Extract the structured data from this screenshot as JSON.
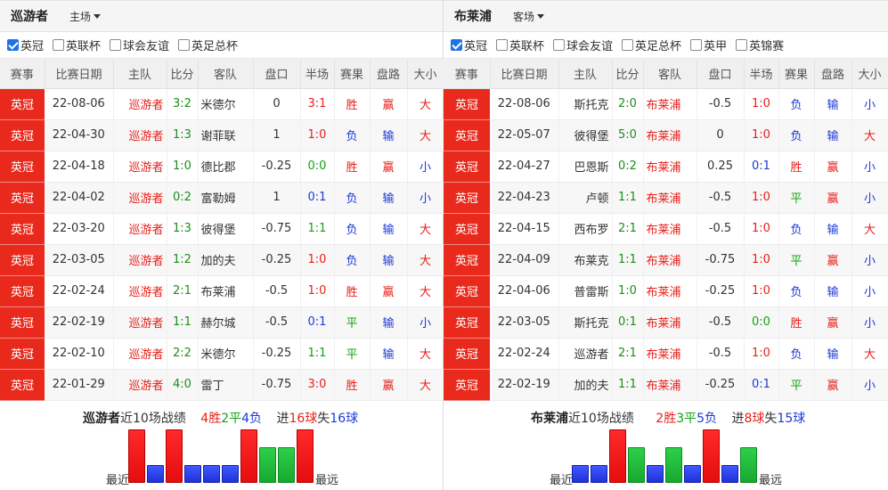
{
  "headers": [
    "赛事",
    "比赛日期",
    "主队",
    "比分",
    "客队",
    "盘口",
    "半场",
    "赛果",
    "盘路",
    "大小"
  ],
  "left": {
    "team": "巡游者",
    "venue": "主场",
    "filters": [
      {
        "label": "英冠",
        "checked": true
      },
      {
        "label": "英联杯",
        "checked": false
      },
      {
        "label": "球会友谊",
        "checked": false
      },
      {
        "label": "英足总杯",
        "checked": false
      }
    ],
    "rows": [
      {
        "comp": "英冠",
        "date": "22-08-06",
        "home": "巡游者",
        "score": "3:2",
        "away": "米德尔",
        "line": "0",
        "half": "3:1",
        "result": "胜",
        "handicap": "赢",
        "ou": "大"
      },
      {
        "comp": "英冠",
        "date": "22-04-30",
        "home": "巡游者",
        "score": "1:3",
        "away": "谢菲联",
        "line": "1",
        "half": "1:0",
        "result": "负",
        "handicap": "输",
        "ou": "大"
      },
      {
        "comp": "英冠",
        "date": "22-04-18",
        "home": "巡游者",
        "score": "1:0",
        "away": "德比郡",
        "line": "-0.25",
        "half": "0:0",
        "result": "胜",
        "handicap": "赢",
        "ou": "小"
      },
      {
        "comp": "英冠",
        "date": "22-04-02",
        "home": "巡游者",
        "score": "0:2",
        "away": "富勒姆",
        "line": "1",
        "half": "0:1",
        "result": "负",
        "handicap": "输",
        "ou": "小"
      },
      {
        "comp": "英冠",
        "date": "22-03-20",
        "home": "巡游者",
        "score": "1:3",
        "away": "彼得堡",
        "line": "-0.75",
        "half": "1:1",
        "result": "负",
        "handicap": "输",
        "ou": "大"
      },
      {
        "comp": "英冠",
        "date": "22-03-05",
        "home": "巡游者",
        "score": "1:2",
        "away": "加的夫",
        "line": "-0.25",
        "half": "1:0",
        "result": "负",
        "handicap": "输",
        "ou": "大"
      },
      {
        "comp": "英冠",
        "date": "22-02-24",
        "home": "巡游者",
        "score": "2:1",
        "away": "布莱浦",
        "line": "-0.5",
        "half": "1:0",
        "result": "胜",
        "handicap": "赢",
        "ou": "大"
      },
      {
        "comp": "英冠",
        "date": "22-02-19",
        "home": "巡游者",
        "score": "1:1",
        "away": "赫尔城",
        "line": "-0.5",
        "half": "0:1",
        "result": "平",
        "handicap": "输",
        "ou": "小"
      },
      {
        "comp": "英冠",
        "date": "22-02-10",
        "home": "巡游者",
        "score": "2:2",
        "away": "米德尔",
        "line": "-0.25",
        "half": "1:1",
        "result": "平",
        "handicap": "输",
        "ou": "大"
      },
      {
        "comp": "英冠",
        "date": "22-01-29",
        "home": "巡游者",
        "score": "4:0",
        "away": "雷丁",
        "line": "-0.75",
        "half": "3:0",
        "result": "胜",
        "handicap": "赢",
        "ou": "大"
      }
    ],
    "summary": {
      "name": "巡游者",
      "text": "近10场战绩",
      "w": "4胜",
      "d": "2平",
      "l": "4负",
      "gf_pre": "进",
      "gf": "16球",
      "ga_pre": "失",
      "ga": "16球"
    },
    "recent_label": "最近",
    "far_label": "最远",
    "form": [
      "W",
      "L",
      "W",
      "L",
      "L",
      "L",
      "W",
      "D",
      "D",
      "W"
    ]
  },
  "right": {
    "team": "布莱浦",
    "venue": "客场",
    "filters": [
      {
        "label": "英冠",
        "checked": true
      },
      {
        "label": "英联杯",
        "checked": false
      },
      {
        "label": "球会友谊",
        "checked": false
      },
      {
        "label": "英足总杯",
        "checked": false
      },
      {
        "label": "英甲",
        "checked": false
      },
      {
        "label": "英锦赛",
        "checked": false
      }
    ],
    "rows": [
      {
        "comp": "英冠",
        "date": "22-08-06",
        "home": "斯托克",
        "score": "2:0",
        "away": "布莱浦",
        "line": "-0.5",
        "half": "1:0",
        "result": "负",
        "handicap": "输",
        "ou": "小"
      },
      {
        "comp": "英冠",
        "date": "22-05-07",
        "home": "彼得堡",
        "score": "5:0",
        "away": "布莱浦",
        "line": "0",
        "half": "1:0",
        "result": "负",
        "handicap": "输",
        "ou": "大"
      },
      {
        "comp": "英冠",
        "date": "22-04-27",
        "home": "巴恩斯",
        "score": "0:2",
        "away": "布莱浦",
        "line": "0.25",
        "half": "0:1",
        "result": "胜",
        "handicap": "赢",
        "ou": "小"
      },
      {
        "comp": "英冠",
        "date": "22-04-23",
        "home": "卢顿",
        "score": "1:1",
        "away": "布莱浦",
        "line": "-0.5",
        "half": "1:0",
        "result": "平",
        "handicap": "赢",
        "ou": "小"
      },
      {
        "comp": "英冠",
        "date": "22-04-15",
        "home": "西布罗",
        "score": "2:1",
        "away": "布莱浦",
        "line": "-0.5",
        "half": "1:0",
        "result": "负",
        "handicap": "输",
        "ou": "大"
      },
      {
        "comp": "英冠",
        "date": "22-04-09",
        "home": "布莱克",
        "score": "1:1",
        "away": "布莱浦",
        "line": "-0.75",
        "half": "1:0",
        "result": "平",
        "handicap": "赢",
        "ou": "小"
      },
      {
        "comp": "英冠",
        "date": "22-04-06",
        "home": "普雷斯",
        "score": "1:0",
        "away": "布莱浦",
        "line": "-0.25",
        "half": "1:0",
        "result": "负",
        "handicap": "输",
        "ou": "小"
      },
      {
        "comp": "英冠",
        "date": "22-03-05",
        "home": "斯托克",
        "score": "0:1",
        "away": "布莱浦",
        "line": "-0.5",
        "half": "0:0",
        "result": "胜",
        "handicap": "赢",
        "ou": "小"
      },
      {
        "comp": "英冠",
        "date": "22-02-24",
        "home": "巡游者",
        "score": "2:1",
        "away": "布莱浦",
        "line": "-0.5",
        "half": "1:0",
        "result": "负",
        "handicap": "输",
        "ou": "大"
      },
      {
        "comp": "英冠",
        "date": "22-02-19",
        "home": "加的夫",
        "score": "1:1",
        "away": "布莱浦",
        "line": "-0.25",
        "half": "0:1",
        "result": "平",
        "handicap": "赢",
        "ou": "小"
      }
    ],
    "summary": {
      "name": "布莱浦",
      "text": "近10场战绩",
      "w": "2胜",
      "d": "3平",
      "l": "5负",
      "gf_pre": "进",
      "gf": "8球",
      "ga_pre": "失",
      "ga": "15球"
    },
    "recent_label": "最近",
    "far_label": "最远",
    "form": [
      "L",
      "L",
      "W",
      "D",
      "L",
      "D",
      "L",
      "W",
      "L",
      "D"
    ]
  }
}
